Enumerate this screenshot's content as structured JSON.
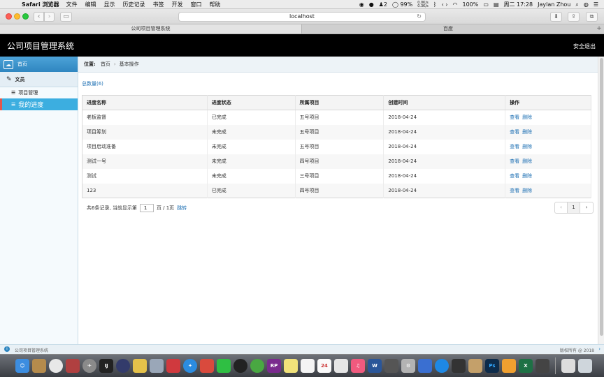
{
  "menubar": {
    "app_name": "Safari 浏览器",
    "items": [
      "文件",
      "编辑",
      "显示",
      "历史记录",
      "书签",
      "开发",
      "窗口",
      "帮助"
    ],
    "wechat_badge": "2",
    "battery": "99%",
    "net_up": "0.0K/s",
    "net_down": "0.3K/s",
    "volume": "100%",
    "clock": "周二 17:28",
    "user": "Jaylan Zhou"
  },
  "browser": {
    "address": "localhost",
    "tabs": [
      "公司项目管理系统",
      "百度"
    ]
  },
  "app": {
    "title": "公司项目管理系统",
    "logout": "安全退出"
  },
  "sidebar": {
    "home": "首页",
    "group": "文员",
    "items": [
      "项目管理",
      "我的进度"
    ]
  },
  "breadcrumb": {
    "label": "位置:",
    "home": "首页",
    "sep": "›",
    "current": "基本操作"
  },
  "total_label": "总数量(6)",
  "table": {
    "headers": [
      "进度名称",
      "进度状态",
      "所属项目",
      "创建时间",
      "操作"
    ],
    "rows": [
      {
        "name": "老板监督",
        "status": "已完成",
        "project": "五号项目",
        "created": "2018-04-24"
      },
      {
        "name": "项目筹划",
        "status": "未完成",
        "project": "五号项目",
        "created": "2018-04-24"
      },
      {
        "name": "项目启动准备",
        "status": "未完成",
        "project": "五号项目",
        "created": "2018-04-24"
      },
      {
        "name": "测试一号",
        "status": "未完成",
        "project": "四号项目",
        "created": "2018-04-24"
      },
      {
        "name": "测试",
        "status": "未完成",
        "project": "三号项目",
        "created": "2018-04-24"
      },
      {
        "name": "123",
        "status": "已完成",
        "project": "四号项目",
        "created": "2018-04-24"
      }
    ],
    "action_view": "查看",
    "action_delete": "删除"
  },
  "pager": {
    "summary_prefix": "共6条记录,  当前显示第",
    "current_input": "1",
    "summary_suffix": "页 / 1页",
    "jump": "跳转",
    "prev": "‹",
    "page": "1",
    "next": "›"
  },
  "footer": {
    "left": "公司项目管理系统",
    "right": "版权所有 @ 2018"
  },
  "dock": {
    "badges": [
      "RP",
      "24",
      "Ps"
    ]
  }
}
